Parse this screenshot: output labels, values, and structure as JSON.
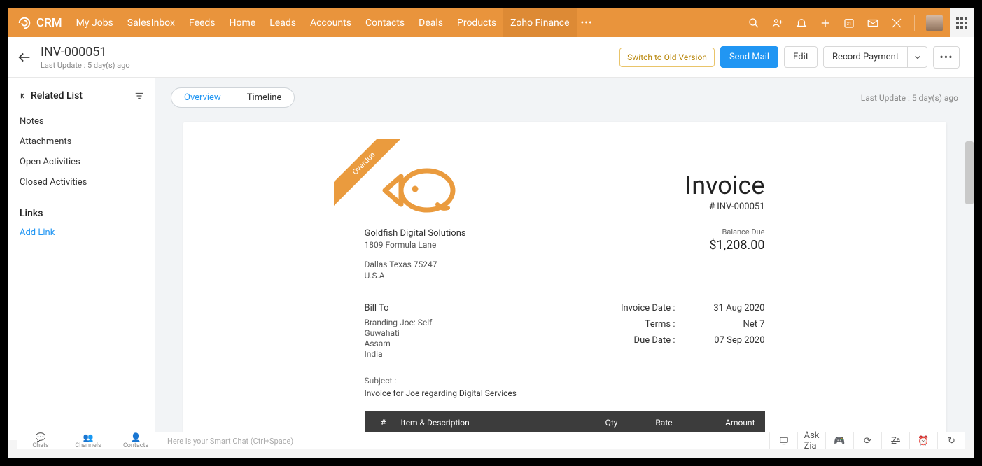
{
  "topnav": {
    "brand": "CRM",
    "items": [
      "My Jobs",
      "SalesInbox",
      "Feeds",
      "Home",
      "Leads",
      "Accounts",
      "Contacts",
      "Deals",
      "Products",
      "Zoho Finance"
    ],
    "active_index": 9
  },
  "header": {
    "title": "INV-000051",
    "subtitle": "Last Update : 5 day(s) ago",
    "switch_label": "Switch to Old Version",
    "send_mail": "Send Mail",
    "edit": "Edit",
    "record_payment": "Record Payment"
  },
  "sidebar": {
    "related_head": "Related List",
    "items": [
      "Notes",
      "Attachments",
      "Open Activities",
      "Closed Activities"
    ],
    "links_head": "Links",
    "add_link": "Add Link"
  },
  "tabs": {
    "overview": "Overview",
    "timeline": "Timeline",
    "update_text": "Last Update : 5 day(s) ago"
  },
  "invoice": {
    "ribbon": "Overdue",
    "company": {
      "name": "Goldfish Digital Solutions",
      "addr1": "1809  Formula Lane",
      "addr2": "Dallas Texas 75247",
      "country": "U.S.A"
    },
    "title": "Invoice",
    "number": "# INV-000051",
    "balance_label": "Balance Due",
    "balance_amount": "$1,208.00",
    "bill_to": {
      "head": "Bill To",
      "lines": [
        "Branding Joe: Self",
        "Guwahati",
        " Assam",
        "India"
      ]
    },
    "meta": {
      "invoice_date_label": "Invoice Date :",
      "invoice_date": "31 Aug 2020",
      "terms_label": "Terms :",
      "terms": "Net 7",
      "due_date_label": "Due Date :",
      "due_date": "07 Sep 2020"
    },
    "subject_label": "Subject :",
    "subject": "Invoice for Joe regarding Digital Services",
    "columns": {
      "num": "#",
      "desc": "Item & Description",
      "qty": "Qty",
      "rate": "Rate",
      "amount": "Amount"
    }
  },
  "bottom": {
    "chats": "Chats",
    "channels": "Channels",
    "contacts": "Contacts",
    "smart_chat": "Here is your Smart Chat (Ctrl+Space)",
    "ask_zia": "Ask Zia"
  }
}
